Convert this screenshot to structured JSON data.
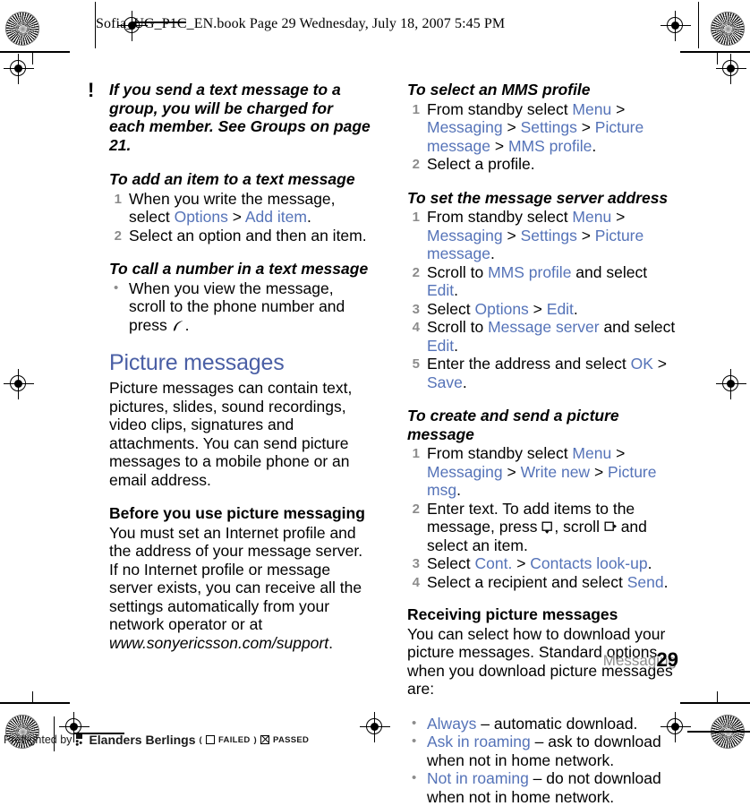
{
  "header": {
    "slug": "Sofia_UG_P1C_EN.book  Page 29  Wednesday, July 18, 2007  5:45 PM"
  },
  "footer": {
    "running_head": "Messaging",
    "page_number": "29",
    "preflight_prefix": "Preflighted by",
    "preflight_company": "Elanders Berlings",
    "preflight_failed_open": "(",
    "preflight_failed_label": "FAILED",
    "preflight_failed_close": ")",
    "preflight_passed_label": "PASSED"
  },
  "left_column": {
    "note": {
      "marker": "!",
      "text": "If you send a text message to a group, you will be charged for each member. See Groups on page 21."
    },
    "procedure_add_item": {
      "title": "To add an item to a text message",
      "steps": [
        {
          "num": "1",
          "parts": [
            {
              "text": "When you write the message, select ",
              "style": "plain"
            },
            {
              "text": "Options",
              "style": "link"
            },
            {
              "text": " > ",
              "style": "plain"
            },
            {
              "text": "Add item",
              "style": "link"
            },
            {
              "text": ".",
              "style": "plain"
            }
          ]
        },
        {
          "num": "2",
          "parts": [
            {
              "text": "Select an option and then an item.",
              "style": "plain"
            }
          ]
        }
      ]
    },
    "procedure_call_number": {
      "title": "To call a number in a text message",
      "bullets": [
        {
          "marker": "•",
          "parts": [
            {
              "text": "When you view the message, scroll to the phone number and press ",
              "style": "plain"
            },
            {
              "text": "",
              "style": "icon-call"
            },
            {
              "text": ".",
              "style": "plain"
            }
          ]
        }
      ]
    },
    "section": {
      "heading": "Picture messages",
      "intro": "Picture messages can contain text, pictures, slides, sound recordings, video clips, signatures and attachments. You can send picture messages to a mobile phone or an email address.",
      "subheading": "Before you use picture messaging",
      "body_pre": "You must set an Internet profile and the address of your message server. If no Internet profile or message server exists, you can receive all the settings automatically from your network operator or at ",
      "body_url": "www.sonyericsson.com/support",
      "body_post": "."
    }
  },
  "right_column": {
    "procedure_mms_profile": {
      "title": "To select an MMS profile",
      "steps": [
        {
          "num": "1",
          "parts": [
            {
              "text": "From standby select ",
              "style": "plain"
            },
            {
              "text": "Menu",
              "style": "link"
            },
            {
              "text": " > ",
              "style": "plain"
            },
            {
              "text": "Messaging",
              "style": "link"
            },
            {
              "text": " > ",
              "style": "plain"
            },
            {
              "text": "Settings",
              "style": "link"
            },
            {
              "text": " > ",
              "style": "plain"
            },
            {
              "text": "Picture message",
              "style": "link"
            },
            {
              "text": " > ",
              "style": "plain"
            },
            {
              "text": "MMS profile",
              "style": "link"
            },
            {
              "text": ".",
              "style": "plain"
            }
          ]
        },
        {
          "num": "2",
          "parts": [
            {
              "text": "Select a profile.",
              "style": "plain"
            }
          ]
        }
      ]
    },
    "procedure_server_address": {
      "title": "To set the message server address",
      "steps": [
        {
          "num": "1",
          "parts": [
            {
              "text": "From standby select ",
              "style": "plain"
            },
            {
              "text": "Menu",
              "style": "link"
            },
            {
              "text": " > ",
              "style": "plain"
            },
            {
              "text": "Messaging",
              "style": "link"
            },
            {
              "text": " > ",
              "style": "plain"
            },
            {
              "text": "Settings",
              "style": "link"
            },
            {
              "text": " > ",
              "style": "plain"
            },
            {
              "text": "Picture message",
              "style": "link"
            },
            {
              "text": ".",
              "style": "plain"
            }
          ]
        },
        {
          "num": "2",
          "parts": [
            {
              "text": "Scroll to ",
              "style": "plain"
            },
            {
              "text": "MMS profile",
              "style": "link"
            },
            {
              "text": " and select ",
              "style": "plain"
            },
            {
              "text": "Edit",
              "style": "link"
            },
            {
              "text": ".",
              "style": "plain"
            }
          ]
        },
        {
          "num": "3",
          "parts": [
            {
              "text": "Select ",
              "style": "plain"
            },
            {
              "text": "Options",
              "style": "link"
            },
            {
              "text": " > ",
              "style": "plain"
            },
            {
              "text": "Edit",
              "style": "link"
            },
            {
              "text": ".",
              "style": "plain"
            }
          ]
        },
        {
          "num": "4",
          "parts": [
            {
              "text": "Scroll to ",
              "style": "plain"
            },
            {
              "text": "Message server",
              "style": "link"
            },
            {
              "text": " and select ",
              "style": "plain"
            },
            {
              "text": "Edit",
              "style": "link"
            },
            {
              "text": ".",
              "style": "plain"
            }
          ]
        },
        {
          "num": "5",
          "parts": [
            {
              "text": "Enter the address and select ",
              "style": "plain"
            },
            {
              "text": "OK",
              "style": "link"
            },
            {
              "text": " > ",
              "style": "plain"
            },
            {
              "text": "Save",
              "style": "link"
            },
            {
              "text": ".",
              "style": "plain"
            }
          ]
        }
      ]
    },
    "procedure_create_send": {
      "title": "To create and send a picture message",
      "steps": [
        {
          "num": "1",
          "parts": [
            {
              "text": "From standby select ",
              "style": "plain"
            },
            {
              "text": "Menu",
              "style": "link"
            },
            {
              "text": " > ",
              "style": "plain"
            },
            {
              "text": "Messaging",
              "style": "link"
            },
            {
              "text": " > ",
              "style": "plain"
            },
            {
              "text": "Write new",
              "style": "link"
            },
            {
              "text": " > ",
              "style": "plain"
            },
            {
              "text": "Picture msg",
              "style": "link"
            },
            {
              "text": ".",
              "style": "plain"
            }
          ]
        },
        {
          "num": "2",
          "parts": [
            {
              "text": "Enter text. To add items to the message, press ",
              "style": "plain"
            },
            {
              "text": "",
              "style": "icon-key-down"
            },
            {
              "text": ", scroll ",
              "style": "plain"
            },
            {
              "text": "",
              "style": "icon-key-right"
            },
            {
              "text": " and select an item.",
              "style": "plain"
            }
          ]
        },
        {
          "num": "3",
          "parts": [
            {
              "text": "Select ",
              "style": "plain"
            },
            {
              "text": "Cont.",
              "style": "link"
            },
            {
              "text": " > ",
              "style": "plain"
            },
            {
              "text": "Contacts look-up",
              "style": "link"
            },
            {
              "text": ".",
              "style": "plain"
            }
          ]
        },
        {
          "num": "4",
          "parts": [
            {
              "text": "Select a recipient and select ",
              "style": "plain"
            },
            {
              "text": "Send",
              "style": "link"
            },
            {
              "text": ".",
              "style": "plain"
            }
          ]
        }
      ]
    },
    "receiving": {
      "subheading": "Receiving picture messages",
      "body": "You can select how to download your picture messages. Standard options when you download picture messages are:",
      "bullets": [
        {
          "marker": "•",
          "parts": [
            {
              "text": "Always",
              "style": "link"
            },
            {
              "text": " – automatic download.",
              "style": "plain"
            }
          ]
        },
        {
          "marker": "•",
          "parts": [
            {
              "text": "Ask in roaming",
              "style": "link"
            },
            {
              "text": " – ask to download when not in home network.",
              "style": "plain"
            }
          ]
        },
        {
          "marker": "•",
          "parts": [
            {
              "text": "Not in roaming",
              "style": "link"
            },
            {
              "text": " – do not download when not in home network.",
              "style": "plain"
            }
          ]
        }
      ]
    }
  },
  "colors": {
    "link": "#5573b8",
    "section_heading": "#4a5fa5",
    "list_marker": "#8c8c8c",
    "running_head": "#8c8c8c",
    "body": "#000000"
  },
  "print_marks": {
    "registration_icon": "registration-target",
    "star_icon": "star-density-target"
  }
}
